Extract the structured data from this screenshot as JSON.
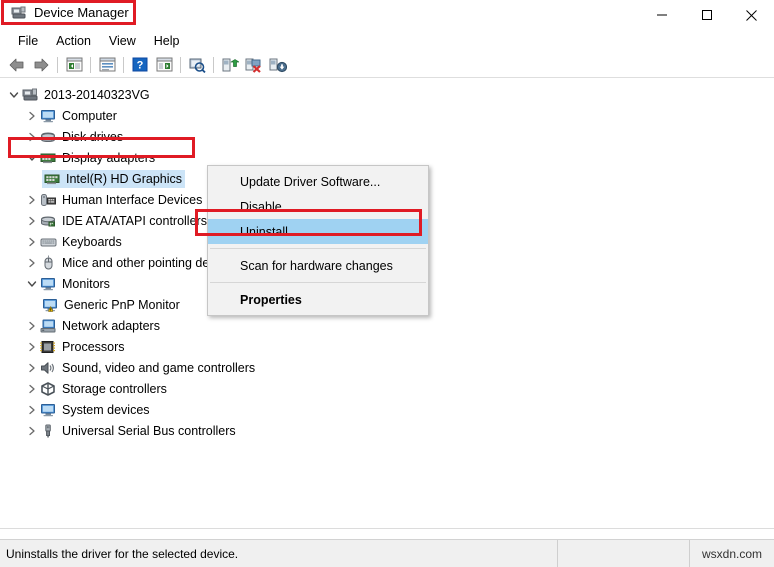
{
  "window": {
    "title": "Device Manager",
    "title_icon": "device-manager-icon",
    "controls": [
      {
        "name": "minimize-button",
        "glyph": "minimize"
      },
      {
        "name": "maximize-button",
        "glyph": "maximize"
      },
      {
        "name": "close-button",
        "glyph": "close"
      }
    ]
  },
  "menubar": {
    "items": [
      {
        "label": "File"
      },
      {
        "label": "Action"
      },
      {
        "label": "View"
      },
      {
        "label": "Help"
      }
    ]
  },
  "toolbar": {
    "buttons": [
      {
        "name": "back-button",
        "icon": "back-arrow-icon"
      },
      {
        "name": "forward-button",
        "icon": "forward-arrow-icon"
      },
      {
        "name": "show-hide-console-tree-button",
        "icon": "console-tree-icon"
      },
      {
        "name": "properties-button",
        "icon": "properties-window-icon"
      },
      {
        "name": "help-button",
        "icon": "help-question-icon"
      },
      {
        "name": "show-hide-action-pane-button",
        "icon": "action-pane-icon"
      },
      {
        "name": "scan-for-hardware-changes-button",
        "icon": "scan-magnifier-icon"
      },
      {
        "name": "update-driver-software-button",
        "icon": "update-driver-icon"
      },
      {
        "name": "uninstall-button",
        "icon": "uninstall-red-x-icon"
      },
      {
        "name": "disable-button",
        "icon": "disable-down-arrow-icon"
      }
    ]
  },
  "tree": {
    "nodes": [
      {
        "label": "2013-20140323VG",
        "icon": "computer-root-icon",
        "indent": 0,
        "state": "expanded"
      },
      {
        "label": "Computer",
        "icon": "computer-icon",
        "indent": 1,
        "state": "collapsed"
      },
      {
        "label": "Disk drives",
        "icon": "disk-drive-icon",
        "indent": 1,
        "state": "collapsed"
      },
      {
        "label": "Display adapters",
        "icon": "display-adapter-icon",
        "indent": 1,
        "state": "expanded"
      },
      {
        "label": "Intel(R) HD Graphics",
        "icon": "display-adapter-icon",
        "indent": 2,
        "state": "leaf",
        "selected": true
      },
      {
        "label": "Human Interface Devices",
        "icon": "hid-icon",
        "indent": 1,
        "state": "collapsed"
      },
      {
        "label": "IDE ATA/ATAPI controllers",
        "icon": "ide-controller-icon",
        "indent": 1,
        "state": "collapsed"
      },
      {
        "label": "Keyboards",
        "icon": "keyboard-icon",
        "indent": 1,
        "state": "collapsed"
      },
      {
        "label": "Mice and other pointing devices",
        "icon": "mouse-icon",
        "indent": 1,
        "state": "collapsed"
      },
      {
        "label": "Monitors",
        "icon": "monitor-icon",
        "indent": 1,
        "state": "expanded"
      },
      {
        "label": "Generic PnP Monitor",
        "icon": "monitor-warning-icon",
        "indent": 2,
        "state": "leaf"
      },
      {
        "label": "Network adapters",
        "icon": "network-adapter-icon",
        "indent": 1,
        "state": "collapsed"
      },
      {
        "label": "Processors",
        "icon": "processor-icon",
        "indent": 1,
        "state": "collapsed"
      },
      {
        "label": "Sound, video and game controllers",
        "icon": "sound-speaker-icon",
        "indent": 1,
        "state": "collapsed"
      },
      {
        "label": "Storage controllers",
        "icon": "storage-controller-icon",
        "indent": 1,
        "state": "collapsed"
      },
      {
        "label": "System devices",
        "icon": "system-device-icon",
        "indent": 1,
        "state": "collapsed"
      },
      {
        "label": "Universal Serial Bus controllers",
        "icon": "usb-controller-icon",
        "indent": 1,
        "state": "collapsed"
      }
    ]
  },
  "context_menu": {
    "items": [
      {
        "label": "Update Driver Software...",
        "type": "item"
      },
      {
        "label": "Disable",
        "type": "item"
      },
      {
        "label": "Uninstall",
        "type": "item",
        "highlighted": true
      },
      {
        "type": "separator"
      },
      {
        "label": "Scan for hardware changes",
        "type": "item"
      },
      {
        "type": "separator"
      },
      {
        "label": "Properties",
        "type": "item",
        "bold": true
      }
    ]
  },
  "statusbar": {
    "message": "Uninstalls the driver for the selected device.",
    "pane2": "",
    "watermark": "wsxdn.com"
  },
  "colors": {
    "highlight_red": "#e01b24",
    "menu_selection_blue": "#9fd2f2",
    "tree_selection_blue": "#cce4f7"
  }
}
